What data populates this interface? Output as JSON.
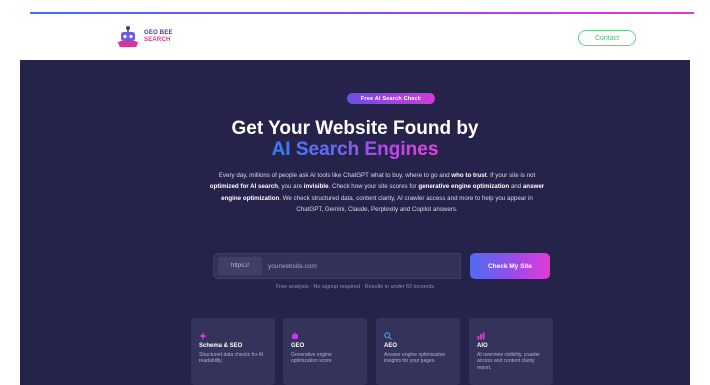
{
  "colors": {
    "page_bg": "#ffffff",
    "hero_bg": "#252349",
    "card_bg": "#34335c",
    "accent_gradient": [
      "#2f7ff4",
      "#6a66f0",
      "#b247e6",
      "#e83ed7"
    ],
    "header_button_border": "#62d486"
  },
  "header": {
    "logo_icon": "robot-logo-icon",
    "logo_line1": "GEO BEE",
    "logo_line2": "SEARCH",
    "button_label": "Contact"
  },
  "hero": {
    "badge": "Free AI Search Check",
    "title_line1": "Get Your Website Found by",
    "title_line2": "AI Search Engines",
    "description": {
      "p1": "Every day, millions of people ask AI tools like ChatGPT what to buy, where to go and ",
      "b1": "who to trust",
      "p2": ". If your site is not ",
      "b2": "optimized for AI search",
      "p3": ", you are ",
      "b3": "invisible",
      "p4": ". Check how your site scores for ",
      "b4": "generative engine optimization",
      "p5": " and ",
      "b5": "answer engine optimization",
      "p6": ". We check structured data, content clarity, AI crawler access and more to help you appear in ChatGPT, Gemini, Claude, Perplexity and Copilot answers."
    }
  },
  "form": {
    "prefix": "https://",
    "placeholder": "yourwebsite.com",
    "value": "",
    "submit_label": "Check My Site"
  },
  "note": "Free analysis · No signup required · Results in under 60 seconds",
  "cards": [
    {
      "icon": "spark-icon",
      "icon_color": "#e23ad6",
      "title": "Schema & SEO",
      "text": "Structured data checks for AI readability."
    },
    {
      "icon": "bot-icon",
      "icon_color": "#c43ce8",
      "title": "GEO",
      "text": "Generative engine optimization score."
    },
    {
      "icon": "search-icon",
      "icon_color": "#2f9ff4",
      "title": "AEO",
      "text": "Answer engine optimization insights for your pages."
    },
    {
      "icon": "chart-icon",
      "icon_color": "#e23ad6",
      "title": "AIO",
      "text": "AI overview visibility, crawler access and content clarity report."
    }
  ]
}
